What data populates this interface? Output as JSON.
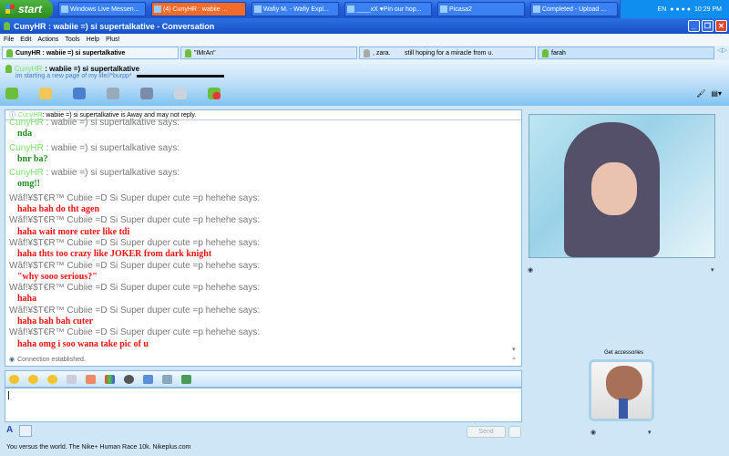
{
  "taskbar": {
    "start": "start",
    "tasks": [
      "Windows Live Messen...",
      "(4) CunyHR : wabiie ...",
      "Wafiy M. - Wafiy Expl...",
      "____xX ♥Pin our hop...",
      "Picasa2",
      "Completed - Upload ..."
    ],
    "lang": "EN",
    "clock": "10:29 PM"
  },
  "window": {
    "title": "CunyHR : wabiie =) si supertalkative - Conversation"
  },
  "menu": [
    "File",
    "Edit",
    "Actions",
    "Tools",
    "Help",
    "Plus!"
  ],
  "tabs": [
    {
      "label": "CunyHR : wabiie =) si supertalkative"
    },
    {
      "label": "\"IMrAn\""
    },
    {
      "label": ", zara.        still hoping for a miracle from u."
    },
    {
      "label": "farah"
    }
  ],
  "contact": {
    "nick": "CunyHR",
    "name": " : wabiie =) si supertalkative",
    "psm": "im starting a new page of my life//*burpp*"
  },
  "toolbar": [
    "invite-icon",
    "share-files-icon",
    "video-call-icon",
    "call-icon",
    "activities-icon",
    "games-icon",
    "block-icon"
  ],
  "away_notice": {
    "nick": "CunyHR",
    "text": " : wabiie =) si supertalkative is Away and may not reply."
  },
  "messages": [
    {
      "nick": "CunyHR",
      "who": " : wabiie =) si supertalkative says:",
      "text": "nda",
      "color": "green"
    },
    {
      "nick": "CunyHR",
      "who": " : wabiie =) si supertalkative says:",
      "text": "bnr ba?",
      "color": "green"
    },
    {
      "nick": "CunyHR",
      "who": " : wabiie =) si supertalkative says:",
      "text": "omg!!",
      "color": "green"
    },
    {
      "nick": "",
      "who": "Wâf!¥$T€R™ Cubiie =D Si Super duper cute =p hehehe says:",
      "text": "haha bah do tht agen",
      "color": "red"
    },
    {
      "nick": "",
      "who": "Wâf!¥$T€R™ Cubiie =D Si Super duper cute =p hehehe says:",
      "text": "haha wait more cuter like tdi",
      "color": "red"
    },
    {
      "nick": "",
      "who": "Wâf!¥$T€R™ Cubiie =D Si Super duper cute =p hehehe says:",
      "text": "haha thts too crazy like JOKER from dark knight",
      "color": "red"
    },
    {
      "nick": "",
      "who": "Wâf!¥$T€R™ Cubiie =D Si Super duper cute =p hehehe says:",
      "text": "\"why sooo serious?\"",
      "color": "red"
    },
    {
      "nick": "",
      "who": "Wâf!¥$T€R™ Cubiie =D Si Super duper cute =p hehehe says:",
      "text": "haha",
      "color": "red"
    },
    {
      "nick": "",
      "who": "Wâf!¥$T€R™ Cubiie =D Si Super duper cute =p hehehe says:",
      "text": "haha bah bah cuter",
      "color": "red"
    },
    {
      "nick": "",
      "who": "Wâf!¥$T€R™ Cubiie =D Si Super duper cute =p hehehe says:",
      "text": "haha omg i soo wana take pic of u",
      "color": "red"
    }
  ],
  "status": "Connection established.",
  "input": {
    "value": ""
  },
  "send_label": "Send",
  "accessories_label": "Get accessories",
  "footer": "You versus the world. The Nike+ Human Race 10k. Nikeplus.com"
}
